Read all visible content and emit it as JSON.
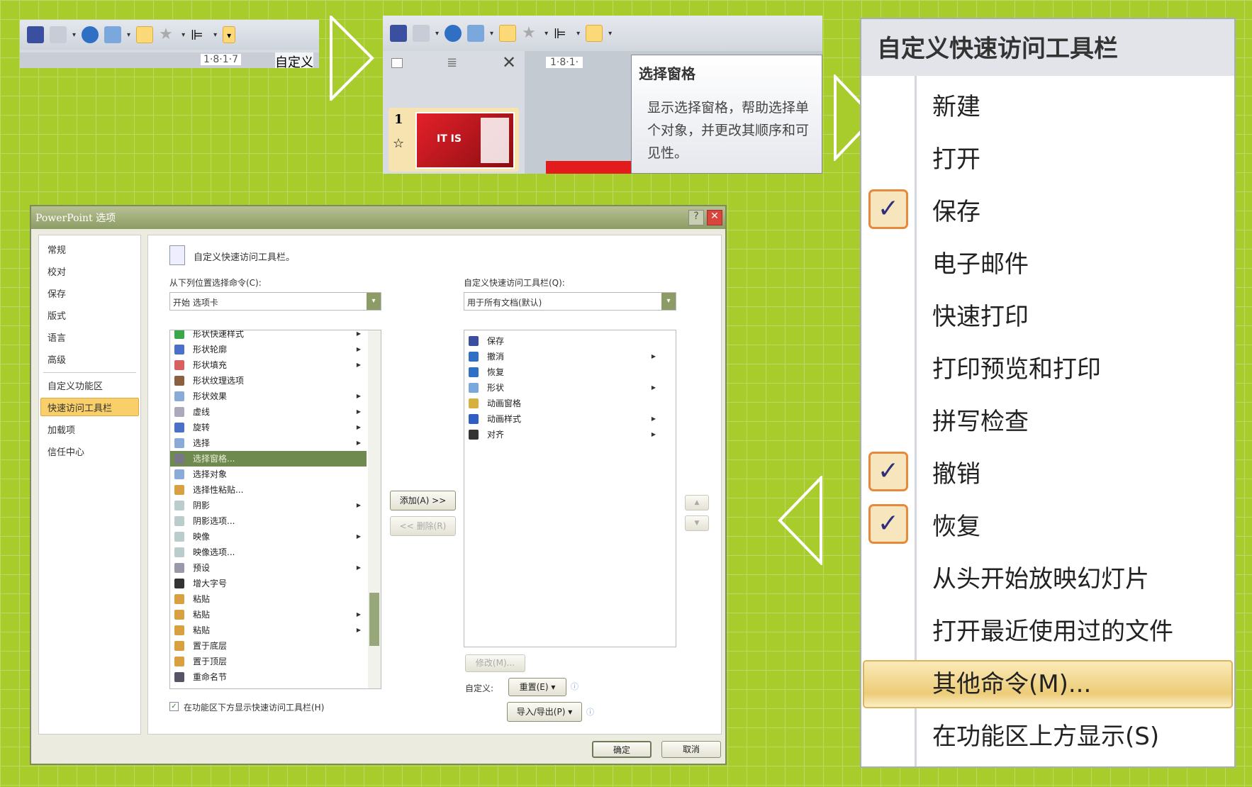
{
  "panel1": {
    "ruler": "1·8·1·7",
    "tooltip_partial": "自定义"
  },
  "panel2": {
    "ruler": "1·8·1·",
    "slide_number": "1",
    "slide_text": "IT IS",
    "tooltip_title": "选择窗格",
    "tooltip_body": "显示选择窗格，帮助选择单个对象，并更改其顺序和可见性。"
  },
  "menu": {
    "title": "自定义快速访问工具栏",
    "items": [
      {
        "label": "新建",
        "checked": false
      },
      {
        "label": "打开",
        "checked": false
      },
      {
        "label": "保存",
        "checked": true
      },
      {
        "label": "电子邮件",
        "checked": false
      },
      {
        "label": "快速打印",
        "checked": false
      },
      {
        "label": "打印预览和打印",
        "checked": false
      },
      {
        "label": "拼写检查",
        "checked": false
      },
      {
        "label": "撤销",
        "checked": true
      },
      {
        "label": "恢复",
        "checked": true
      },
      {
        "label": "从头开始放映幻灯片",
        "checked": false
      },
      {
        "label": "打开最近使用过的文件",
        "checked": false
      },
      {
        "label": "其他命令(M)...",
        "checked": false,
        "highlighted": true
      },
      {
        "label": "在功能区上方显示(S)",
        "checked": false
      }
    ],
    "check_mark": "✓"
  },
  "dialog": {
    "title": "PowerPoint 选项",
    "nav": [
      "常规",
      "校对",
      "保存",
      "版式",
      "语言",
      "高级",
      "自定义功能区",
      "快速访问工具栏",
      "加载项",
      "信任中心"
    ],
    "nav_selected": "快速访问工具栏",
    "heading": "自定义快速访问工具栏。",
    "choose_label": "从下列位置选择命令(C):",
    "choose_value": "开始 选项卡",
    "customize_label": "自定义快速访问工具栏(Q):",
    "customize_value": "用于所有文档(默认)",
    "commands": [
      "形状快速样式",
      "形状轮廓",
      "形状填充",
      "形状纹理选项",
      "形状效果",
      "虚线",
      "旋转",
      "选择",
      "选择窗格...",
      "选择对象",
      "选择性粘贴...",
      "阴影",
      "阴影选项...",
      "映像",
      "映像选项...",
      "预设",
      "增大字号",
      "粘贴",
      "粘贴",
      "粘贴",
      "置于底层",
      "置于顶层",
      "重命名节"
    ],
    "command_selected": "选择窗格...",
    "toolbar_items": [
      "保存",
      "撤消",
      "恢复",
      "形状",
      "动画窗格",
      "动画样式",
      "对齐"
    ],
    "add_button": "添加(A) >>",
    "remove_button": "<< 删除(R)",
    "modify_button": "修改(M)...",
    "customize_text": "自定义:",
    "reset_button": "重置(E) ▾",
    "import_export_button": "导入/导出(P) ▾",
    "show_below_checkbox": "在功能区下方显示快速访问工具栏(H)",
    "show_below_checked": true,
    "ok_button": "确定",
    "cancel_button": "取消",
    "help_icon": "?",
    "close_icon": "✕"
  },
  "colors": {
    "background": "#a8cc2c",
    "highlight": "#fbd977",
    "check_border": "#e7893a",
    "selected_row": "#6f8a4e"
  }
}
